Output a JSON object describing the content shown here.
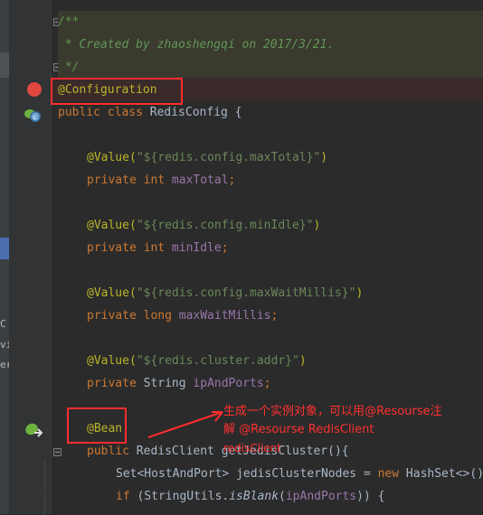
{
  "sidebar_fragments": [
    "C",
    "vi",
    "er"
  ],
  "code": {
    "doc_open": "/**",
    "doc_created": " * Created by zhaoshengqi on 2017/3/21.",
    "doc_close": " */",
    "annotation_configuration": "@Configuration",
    "class_decl_kw": "public class ",
    "class_name": "RedisConfig {",
    "value1_ann": "@Value(",
    "value1_str": "\"${redis.config.maxTotal}\"",
    "value1_close": ")",
    "field1_kw": "private int ",
    "field1_name": "maxTotal",
    "semi": ";",
    "value2_ann": "@Value(",
    "value2_str": "\"${redis.config.minIdle}\"",
    "value2_close": ")",
    "field2_kw": "private int ",
    "field2_name": "minIdle",
    "value3_ann": "@Value(",
    "value3_str": "\"${redis.config.maxWaitMillis}\"",
    "value3_close": ")",
    "field3_kw": "private long ",
    "field3_name": "maxWaitMillis",
    "value4_ann": "@Value(",
    "value4_str": "\"${redis.cluster.addr}\"",
    "value4_close": ")",
    "field4_kw": "private ",
    "field4_type": "String ",
    "field4_name": "ipAndPorts",
    "bean_ann": "@Bean",
    "method_kw": "public ",
    "method_type": "RedisClient ",
    "method_name": "getJedisCluster",
    "method_tail": "(){",
    "line_set_type": "Set<HostAndPort> ",
    "line_set_var": "jedisClusterNodes",
    "line_set_eq": " = ",
    "line_set_new": "new ",
    "line_set_rest": "HashSet<>()",
    "if_kw": "if ",
    "if_open": "(StringUtils.",
    "if_method": "isBlank",
    "if_arg": "(",
    "if_field": "ipAndPorts",
    "if_close": ")) {"
  },
  "annotation_note": {
    "line1": "生成一个实例对象，可以用@Resourse注",
    "line2": "解 @Resourse  RedisClient",
    "line3": "redisClient"
  },
  "colors": {
    "background": "#2b2b2b",
    "keyword": "#cc7832",
    "annotation": "#bbb529",
    "string": "#6a8759",
    "field": "#9876aa",
    "doc_comment": "#629755",
    "highlight_box": "#ff2d2d",
    "breakpoint": "#e0483f"
  },
  "icons": {
    "breakpoint": "breakpoint-icon",
    "class": "spring-class-icon",
    "bean": "spring-bean-icon"
  }
}
